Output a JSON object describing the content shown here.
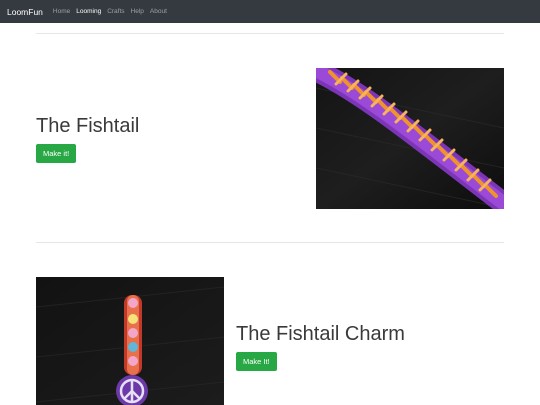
{
  "navbar": {
    "brand": "LoomFun",
    "links": [
      {
        "label": "Home",
        "active": false
      },
      {
        "label": "Looming",
        "active": true
      },
      {
        "label": "Crafts",
        "active": false
      },
      {
        "label": "Help",
        "active": false
      },
      {
        "label": "About",
        "active": false
      }
    ]
  },
  "sections": [
    {
      "title": "The Fishtail",
      "button_label": "Make it!",
      "image_icon": "fishtail-bracelet-photo"
    },
    {
      "title": "The Fishtail Charm",
      "button_label": "Make It!",
      "image_icon": "fishtail-charm-photo"
    }
  ],
  "colors": {
    "navbar_bg": "#343a40",
    "button_bg": "#28a745",
    "band_purple": "#8a3fc4",
    "band_orange": "#f0932b"
  }
}
